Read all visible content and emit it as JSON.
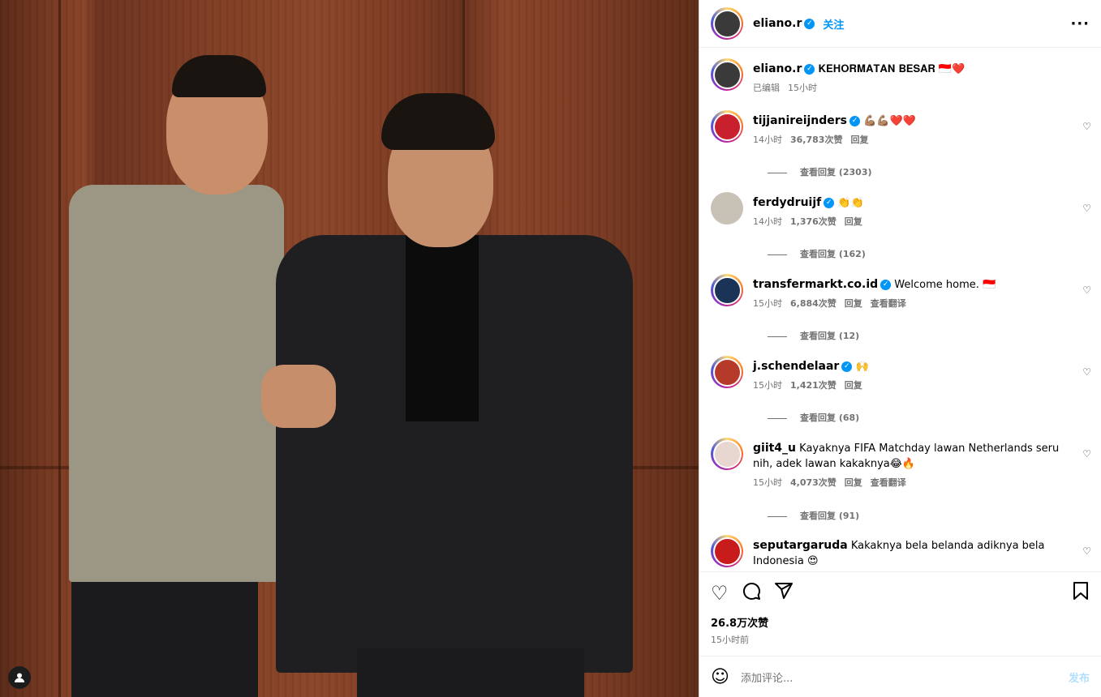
{
  "post": {
    "author": "eliano.r",
    "follow_label": "关注",
    "caption_user": "eliano.r",
    "caption_text": "𝐊𝐄𝐇𝐎𝐑𝐌𝐀𝐓𝐀𝐍 𝐁𝐄𝐒𝐀𝐑 🇮🇩❤️",
    "caption_edited": "已编辑",
    "caption_time": "15小时",
    "more_icon": "more-horizontal-icon"
  },
  "comments": [
    {
      "user": "tijjanireijnders",
      "text": "💪🏽💪🏽❤️❤️",
      "time": "14小时",
      "likes": "36,783次赞",
      "reply": "回复",
      "translate": "",
      "view_replies": "查看回复 (2303)",
      "avatar_color": "#c8202c"
    },
    {
      "user": "ferdydruijf",
      "text": "👏👏",
      "time": "14小时",
      "likes": "1,376次赞",
      "reply": "回复",
      "translate": "",
      "view_replies": "查看回复 (162)",
      "avatar_color": "#c7c1b6"
    },
    {
      "user": "transfermarkt.co.id",
      "text": "Welcome home. 🇮🇩",
      "time": "15小时",
      "likes": "6,884次赞",
      "reply": "回复",
      "translate": "查看翻译",
      "view_replies": "查看回复 (12)",
      "avatar_color": "#1b3357"
    },
    {
      "user": "j.schendelaar",
      "text": "🙌",
      "time": "15小时",
      "likes": "1,421次赞",
      "reply": "回复",
      "translate": "",
      "view_replies": "查看回复 (68)",
      "avatar_color": "#b53a2a"
    },
    {
      "user": "giit4_u",
      "text": "Kayaknya FIFA Matchday lawan Netherlands seru nih, adek lawan kakaknya😂🔥",
      "time": "15小时",
      "likes": "4,073次赞",
      "reply": "回复",
      "translate": "查看翻译",
      "view_replies": "查看回复 (91)",
      "avatar_color": "#e8d6d0"
    },
    {
      "user": "seputargaruda",
      "text": "Kakaknya bela belanda adiknya bela Indonesia 😍",
      "time": "",
      "likes": "",
      "reply": "",
      "translate": "",
      "view_replies": "",
      "avatar_color": "#c81c1c"
    }
  ],
  "actions": {
    "likes": "26.8万次赞",
    "time_ago": "15小时前"
  },
  "add_comment": {
    "placeholder": "添加评论...",
    "post_label": "发布"
  },
  "colors": {
    "accent": "#0095f6",
    "verified": "#0095f6"
  }
}
